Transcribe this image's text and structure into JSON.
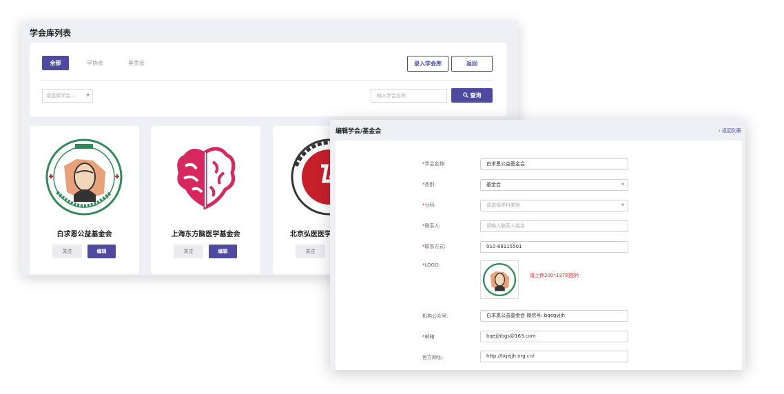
{
  "list_window": {
    "title": "学会库列表",
    "tabs": [
      "全部",
      "学协会",
      "基金会"
    ],
    "enter_button": "录入学会库",
    "back_button": "返回",
    "category_select_placeholder": "请选择学会...",
    "search_placeholder": "输入学会名称",
    "search_button": "查询",
    "follow_label": "关注",
    "edit_label": "编辑",
    "cards": [
      {
        "name": "白求恩公益基金会"
      },
      {
        "name": "上海东方脑医学基金会"
      },
      {
        "name": "北京弘医医学"
      }
    ],
    "accent_color": "#4e4aa0"
  },
  "edit_window": {
    "title": "编辑学会/基金会",
    "back_link": "‹ 返回列表",
    "fields": {
      "name": {
        "label": "学会名称:",
        "value": "白求恩公益基金会"
      },
      "type": {
        "label": "类别:",
        "value": "基金会"
      },
      "category": {
        "label": "分科:",
        "placeholder": "请选择学科类别"
      },
      "contact": {
        "label": "联系人:",
        "placeholder": "请输入联系人姓名"
      },
      "phone": {
        "label": "联系方式:",
        "value": "010-88115501"
      },
      "logo": {
        "label": "LOGO:",
        "tip": "请上传200*137的图片"
      },
      "wechat": {
        "label": "机构公众号:",
        "value": "白求恩公益基金会 微信号: bqegyjjh"
      },
      "email": {
        "label": "邮箱:",
        "value": "bqejjhbgs@163.com"
      },
      "website": {
        "label": "官方网址:",
        "value": "http://bqejjh.org.cn/"
      }
    }
  }
}
